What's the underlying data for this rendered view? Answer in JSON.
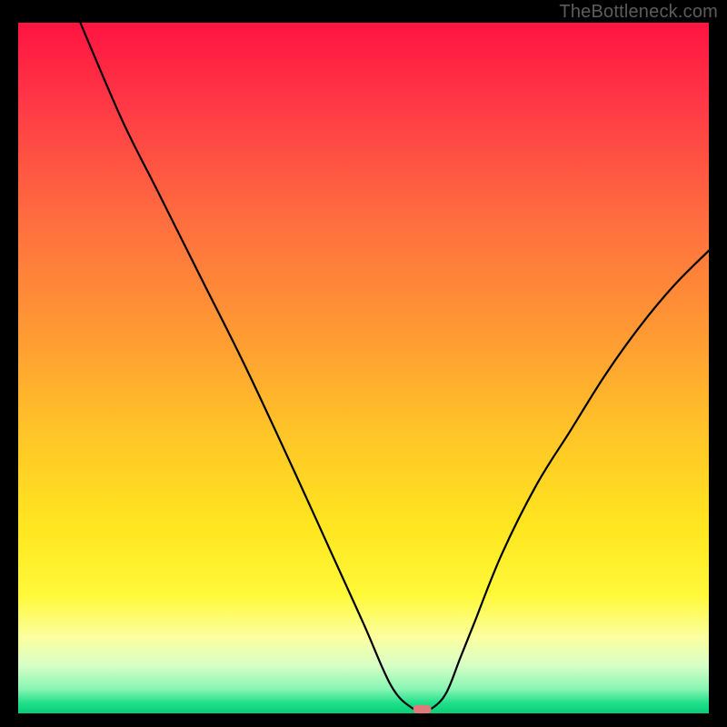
{
  "watermark": "TheBottleneck.com",
  "chart_data": {
    "type": "line",
    "title": "",
    "xlabel": "",
    "ylabel": "",
    "xlim": [
      0,
      100
    ],
    "ylim": [
      0,
      100
    ],
    "series": [
      {
        "name": "curve",
        "x": [
          9,
          15,
          20,
          25,
          27,
          33,
          40,
          45,
          50,
          54,
          57,
          58.5,
          60,
          62,
          64,
          66,
          70,
          75,
          80,
          85,
          90,
          95,
          100
        ],
        "y": [
          100,
          86,
          76,
          66,
          62,
          50,
          35,
          24,
          13,
          4,
          0.8,
          0.6,
          0.8,
          3,
          8,
          13,
          23,
          33,
          41,
          49,
          56,
          62,
          67
        ]
      }
    ],
    "notch": {
      "x_center": 58.5,
      "y": 0.6,
      "width": 2.6,
      "height": 1.2,
      "color": "#e07a7a"
    },
    "gradient_stops": [
      {
        "offset": 0.0,
        "color": "#ff1440"
      },
      {
        "offset": 0.12,
        "color": "#ff3946"
      },
      {
        "offset": 0.28,
        "color": "#ff6c3f"
      },
      {
        "offset": 0.45,
        "color": "#ff9a33"
      },
      {
        "offset": 0.6,
        "color": "#ffc627"
      },
      {
        "offset": 0.73,
        "color": "#ffe61f"
      },
      {
        "offset": 0.83,
        "color": "#fff93a"
      },
      {
        "offset": 0.89,
        "color": "#fbffa0"
      },
      {
        "offset": 0.93,
        "color": "#d8ffc6"
      },
      {
        "offset": 0.965,
        "color": "#87f5b3"
      },
      {
        "offset": 0.985,
        "color": "#1fe08a"
      },
      {
        "offset": 1.0,
        "color": "#0acc78"
      }
    ]
  }
}
